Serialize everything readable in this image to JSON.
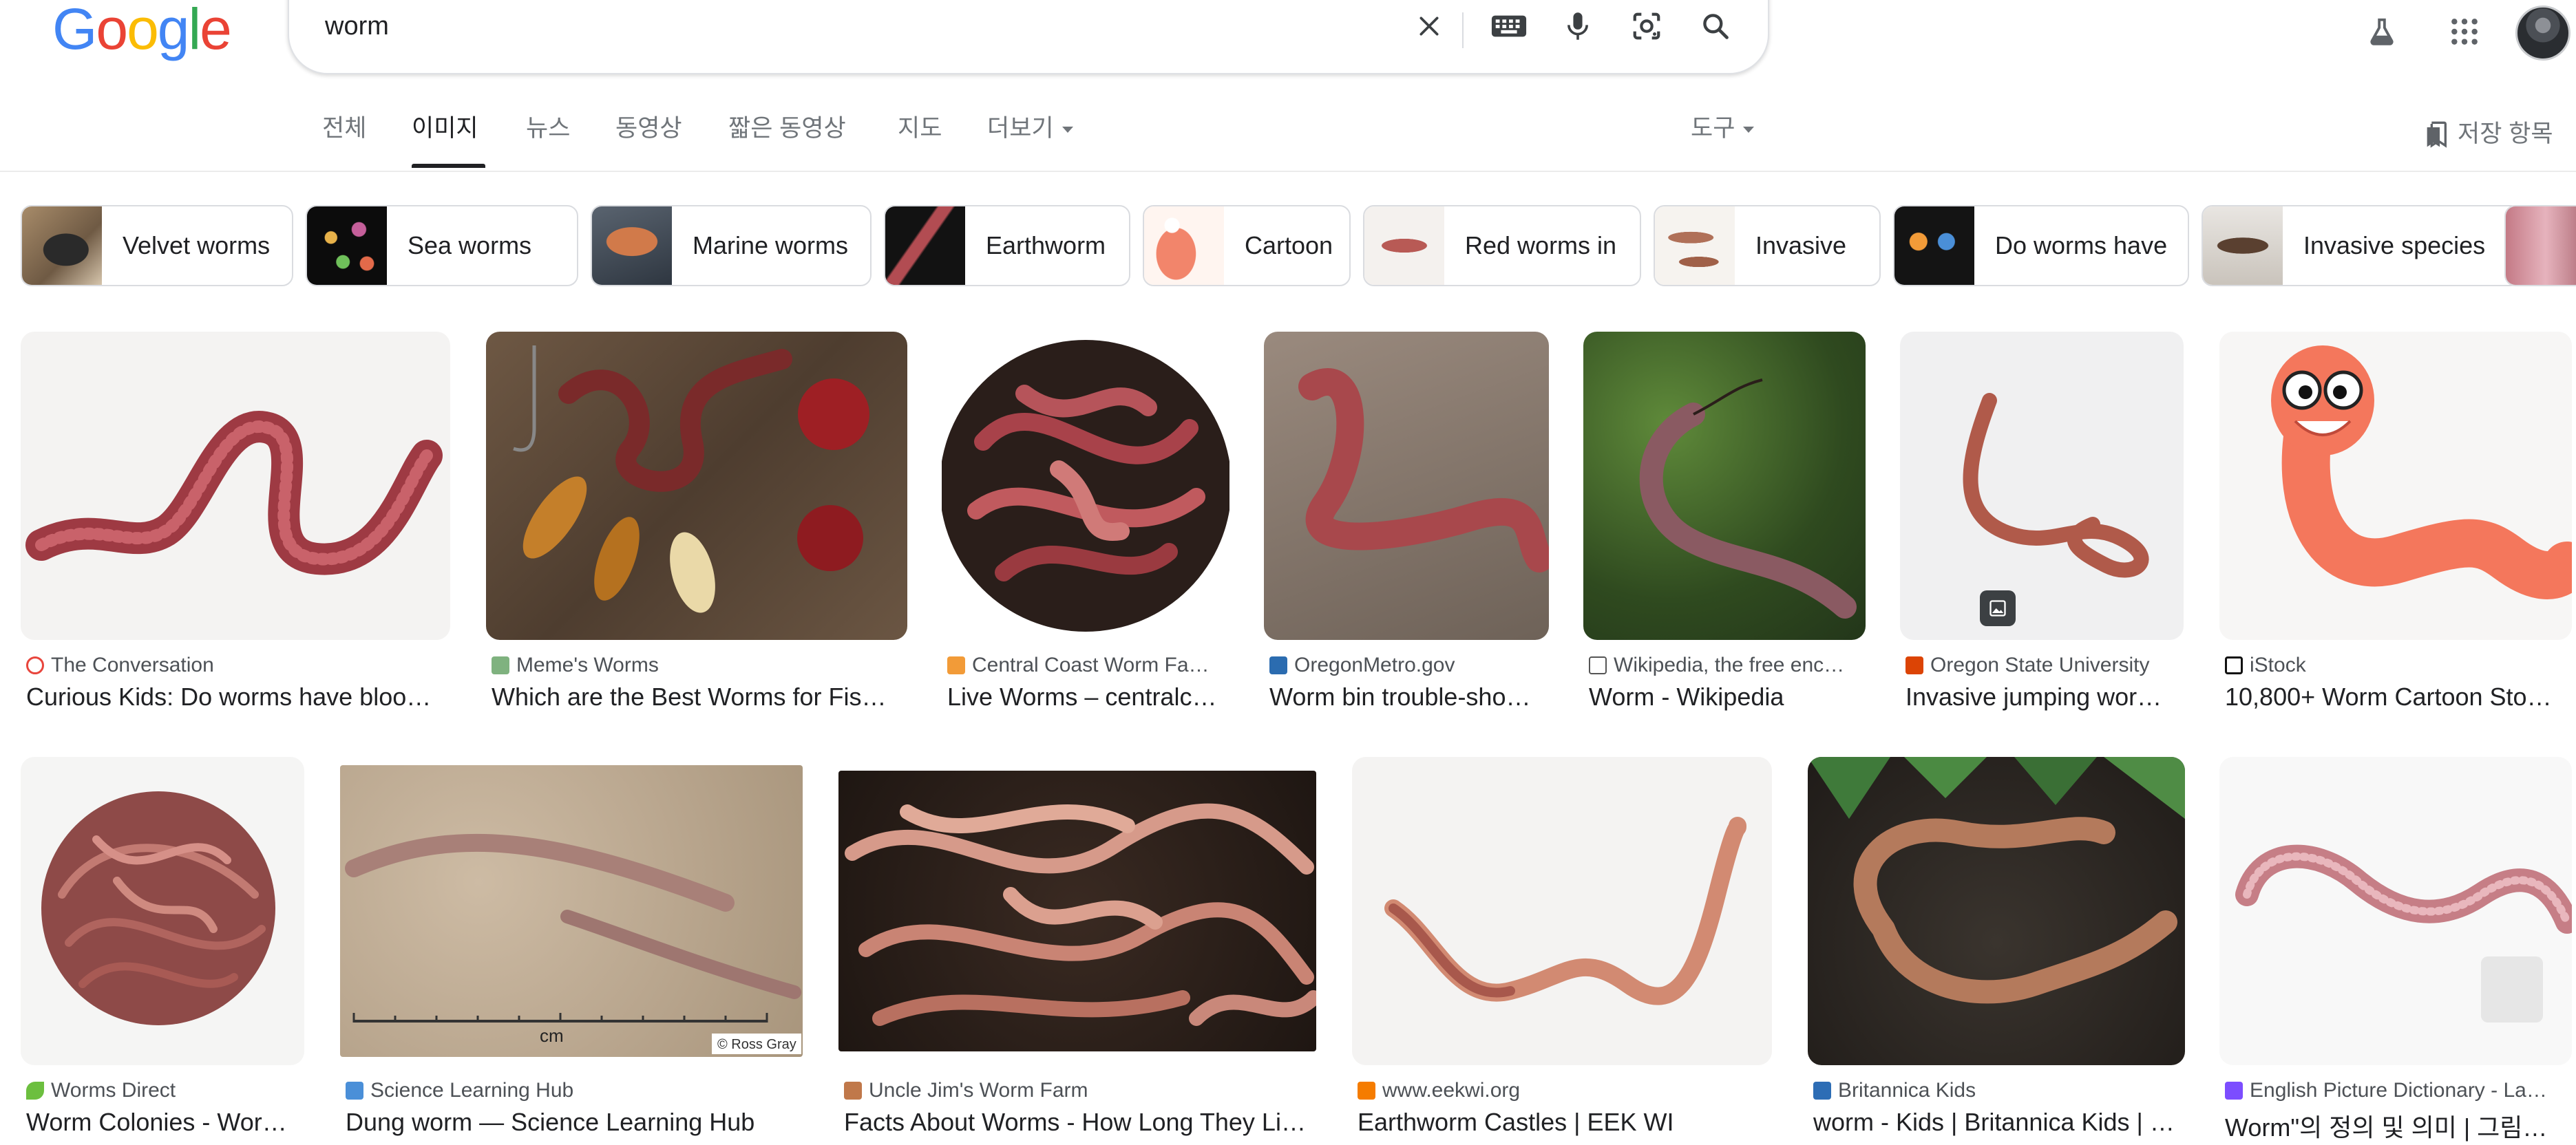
{
  "logo": {
    "letters": [
      "G",
      "o",
      "o",
      "g",
      "l",
      "e"
    ],
    "colors": [
      "#4285f4",
      "#ea4335",
      "#fbbc05",
      "#4285f4",
      "#34a853",
      "#ea4335"
    ]
  },
  "search": {
    "query": "worm"
  },
  "icons": {
    "clear": "close-icon",
    "keyboard": "keyboard-icon",
    "voice": "microphone-icon",
    "lens": "camera-lens-icon",
    "search": "search-icon",
    "labs": "flask-icon",
    "apps": "apps-grid-icon"
  },
  "tabs": [
    {
      "label": "전체"
    },
    {
      "label": "이미지"
    },
    {
      "label": "뉴스"
    },
    {
      "label": "동영상"
    },
    {
      "label": "짧은 동영상"
    },
    {
      "label": "지도"
    },
    {
      "label": "더보기"
    }
  ],
  "tools_label": "도구",
  "saved_label": "저장 항목",
  "chips": [
    {
      "label": "Velvet worms"
    },
    {
      "label": "Sea worms"
    },
    {
      "label": "Marine worms"
    },
    {
      "label": "Earthworm"
    },
    {
      "label": "Cartoon"
    },
    {
      "label": "Red worms in"
    },
    {
      "label": "Invasive"
    },
    {
      "label": "Do worms have"
    },
    {
      "label": "Invasive species"
    },
    {
      "label": ""
    }
  ],
  "results": [
    {
      "source": "The Conversation",
      "title": "Curious Kids: Do worms have bloo…",
      "fav_color": "#e8453c"
    },
    {
      "source": "Meme's Worms",
      "title": "Which are the Best Worms for Fis…",
      "fav_color": "#7fb27f"
    },
    {
      "source": "Central Coast Worm Fa…",
      "title": "Live Worms – centralc…",
      "fav_color": "#f29b38"
    },
    {
      "source": "OregonMetro.gov",
      "title": "Worm bin trouble-sho…",
      "fav_color": "#2b6cb0"
    },
    {
      "source": "Wikipedia, the free enc…",
      "title": "Worm - Wikipedia",
      "fav_color": "#555555"
    },
    {
      "source": "Oregon State University",
      "title": "Invasive jumping wor…",
      "fav_color": "#dc4405"
    },
    {
      "source": "iStock",
      "title": "10,800+ Worm Cartoon Sto…",
      "fav_color": "#111111"
    },
    {
      "source": "Worms Direct",
      "title": "Worm Colonies - Wor…",
      "fav_color": "#6cbf3f"
    },
    {
      "source": "Science Learning Hub",
      "title": "Dung worm — Science Learning Hub",
      "fav_color": "#4a8fd8"
    },
    {
      "source": "Uncle Jim's Worm Farm",
      "title": "Facts About Worms - How Long They Li…",
      "fav_color": "#c0784a"
    },
    {
      "source": "www.eekwi.org",
      "title": "Earthworm Castles | EEK WI",
      "fav_color": "#f57c00"
    },
    {
      "source": "Britannica Kids",
      "title": "worm - Kids | Britannica Kids | …",
      "fav_color": "#2d6db5"
    },
    {
      "source": "English Picture Dictionary - La…",
      "title": "Worm\"의 정의 및 의미 | 그림…",
      "fav_color": "#7c4dff"
    }
  ]
}
